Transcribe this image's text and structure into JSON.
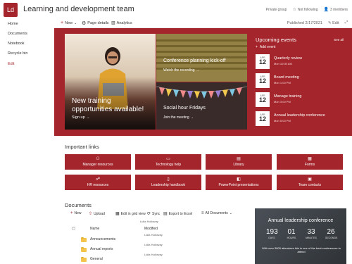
{
  "header": {
    "logo": "Ld",
    "title": "Learning and development team",
    "group": "Private group",
    "follow": "Not following",
    "members": "3 members"
  },
  "nav": [
    "Home",
    "Documents",
    "Notebook",
    "Recycle bin",
    "Edit"
  ],
  "commandbar": {
    "new": "New",
    "page_details": "Page details",
    "analytics": "Analytics",
    "published": "Published 2/17/2021",
    "edit": "Edit"
  },
  "hero": {
    "big_title": "New training opportunities available!",
    "big_link": "Sign up",
    "top_title": "Conference planning kick-off",
    "top_link": "Watch the recording",
    "bottom_title": "Social hour Fridays",
    "bottom_link": "Join the meeting"
  },
  "events": {
    "title": "Upcoming events",
    "see_all": "See all",
    "add": "Add event",
    "items": [
      {
        "month": "APR",
        "day": "12",
        "name": "Quarterly review",
        "sub": "Mon 10:00 AM"
      },
      {
        "month": "APR",
        "day": "12",
        "name": "Board meeting",
        "sub": "Mon 1:00 PM"
      },
      {
        "month": "APR",
        "day": "12",
        "name": "Manage training",
        "sub": "Mon 3:00 PM"
      },
      {
        "month": "APR",
        "day": "12",
        "name": "Annual leadership conference",
        "sub": "Mon 5:00 PM"
      }
    ]
  },
  "links": {
    "title": "Important links",
    "items": [
      "Manager resources",
      "Technology help",
      "Library",
      "Forms",
      "HR resources",
      "Leadership handbook",
      "PowerPoint presentations",
      "Team contacts"
    ]
  },
  "documents": {
    "title": "Documents",
    "toolbar": [
      "New",
      "Upload",
      "Edit in grid view",
      "Sync",
      "Export to Excel",
      "All Documents"
    ],
    "col_name": "Name",
    "col_modified": "Modified",
    "col_by": "Lidia Holloway",
    "rows": [
      {
        "name": "Announcements",
        "modified": "",
        "by": "Lidia Holloway"
      },
      {
        "name": "Annual reports",
        "modified": "",
        "by": "Lidia Holloway"
      },
      {
        "name": "General",
        "modified": "",
        "by": "Lidia Holloway"
      }
    ]
  },
  "countdown": {
    "title": "Annual leadership conference",
    "values": [
      "193",
      "01",
      "33",
      "26"
    ],
    "labels": [
      "DAYS",
      "HOURS",
      "MINUTES",
      "SECONDS"
    ],
    "text": "With over 5000 attendees this is one of the best conferences to attend"
  }
}
